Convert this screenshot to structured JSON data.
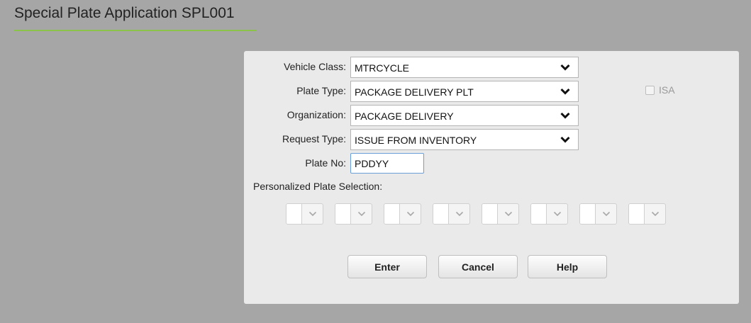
{
  "page": {
    "title": "Special Plate Application SPL001"
  },
  "form": {
    "vehicle_class": {
      "label": "Vehicle Class:",
      "value": "MTRCYCLE"
    },
    "plate_type": {
      "label": "Plate Type:",
      "value": "PACKAGE DELIVERY PLT"
    },
    "organization": {
      "label": "Organization:",
      "value": "PACKAGE DELIVERY"
    },
    "request_type": {
      "label": "Request Type:",
      "value": "ISSUE FROM INVENTORY"
    },
    "plate_no": {
      "label": "Plate No:",
      "value": "PDDYY"
    },
    "isa": {
      "label": "ISA",
      "checked": false,
      "disabled": true
    },
    "personalized": {
      "label": "Personalized Plate Selection:",
      "characters": [
        "",
        "",
        "",
        "",
        "",
        "",
        "",
        ""
      ]
    }
  },
  "buttons": {
    "enter": "Enter",
    "cancel": "Cancel",
    "help": "Help"
  },
  "colors": {
    "background": "#a6a6a6",
    "panel": "#eaeaea",
    "title_underline": "#8bc34a",
    "input_focus_border": "#6a9fd8"
  }
}
